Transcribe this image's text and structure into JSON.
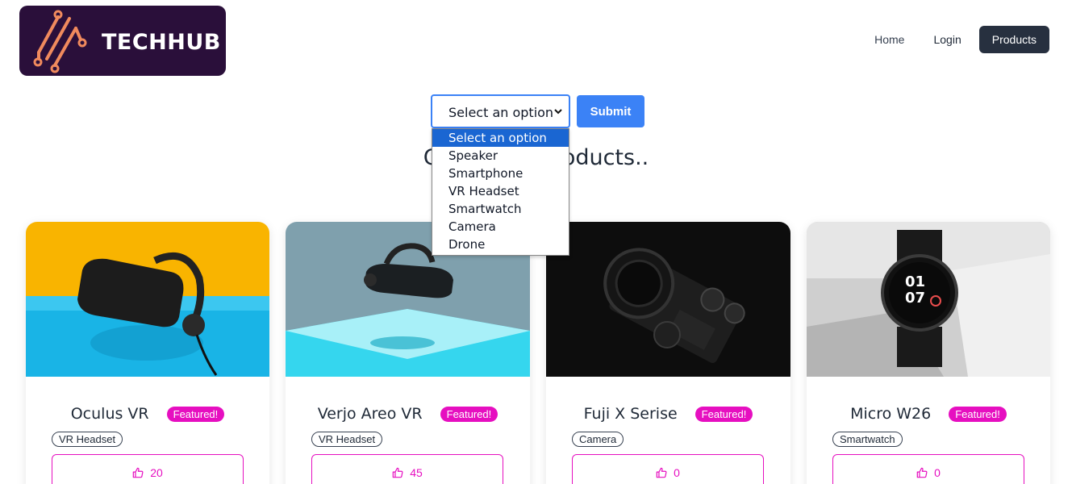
{
  "brand": {
    "name": "TECHHUB"
  },
  "nav": {
    "home": "Home",
    "login": "Login",
    "products": "Products"
  },
  "filter": {
    "selected": "Select an option",
    "submit_label": "Submit",
    "options": [
      "Select an option",
      "Speaker",
      "Smartphone",
      "VR Headset",
      "Smartwatch",
      "Camera",
      "Drone"
    ]
  },
  "heading": "Check out products..",
  "products": [
    {
      "name": "Oculus VR",
      "badge": "Featured!",
      "category": "VR Headset",
      "likes": "20"
    },
    {
      "name": "Verjo Areo VR",
      "badge": "Featured!",
      "category": "VR Headset",
      "likes": "45"
    },
    {
      "name": "Fuji X Serise",
      "badge": "Featured!",
      "category": "Camera",
      "likes": "0"
    },
    {
      "name": "Micro W26",
      "badge": "Featured!",
      "category": "Smartwatch",
      "likes": "0"
    }
  ],
  "colors": {
    "accent": "#3b82f6",
    "featured": "#e60fc0",
    "nav_active": "#27303f",
    "logo_bg": "#2a0f3a"
  }
}
